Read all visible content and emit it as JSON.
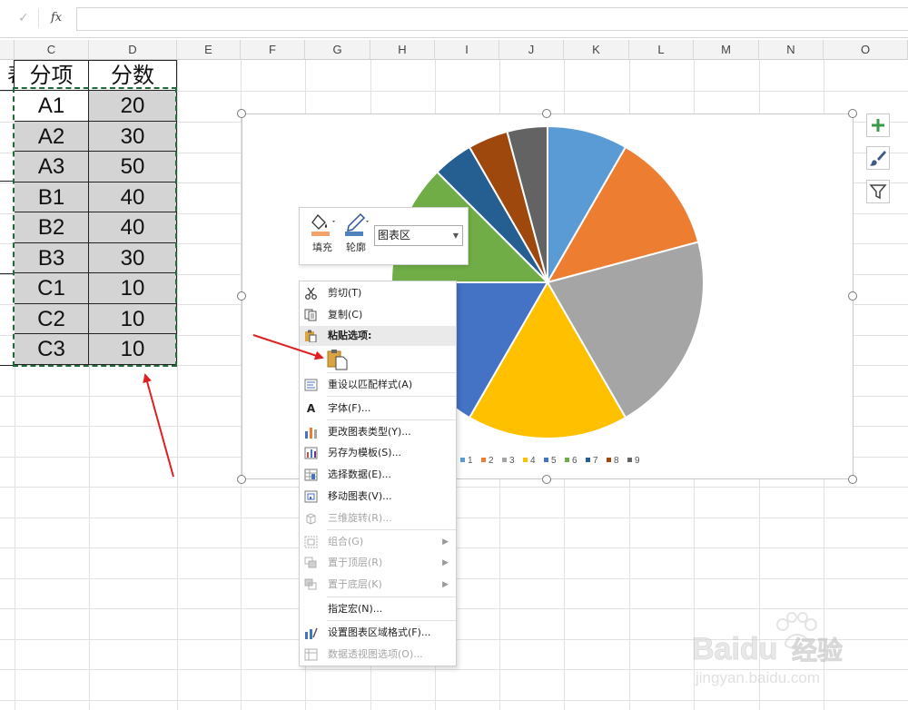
{
  "formula_bar": {
    "check_symbol": "✓",
    "fx_label": "fx",
    "value": ""
  },
  "columns": [
    "C",
    "D",
    "E",
    "F",
    "G",
    "H",
    "I",
    "J",
    "K",
    "L",
    "M",
    "N",
    "O"
  ],
  "partial_column_cell": "表",
  "table": {
    "headers": [
      "分项",
      "分数"
    ],
    "rows": [
      {
        "item": "A1",
        "score": "20"
      },
      {
        "item": "A2",
        "score": "30"
      },
      {
        "item": "A3",
        "score": "50"
      },
      {
        "item": "B1",
        "score": "40"
      },
      {
        "item": "B2",
        "score": "40"
      },
      {
        "item": "B3",
        "score": "30"
      },
      {
        "item": "C1",
        "score": "10"
      },
      {
        "item": "C2",
        "score": "10"
      },
      {
        "item": "C3",
        "score": "10"
      }
    ]
  },
  "chart_data": {
    "type": "pie",
    "slices": [
      {
        "name": "1",
        "value": 20,
        "color": "#5b9bd5"
      },
      {
        "name": "2",
        "value": 30,
        "color": "#ed7d31"
      },
      {
        "name": "3",
        "value": 50,
        "color": "#a5a5a5"
      },
      {
        "name": "4",
        "value": 40,
        "color": "#ffc000"
      },
      {
        "name": "5",
        "value": 40,
        "color": "#4472c4"
      },
      {
        "name": "6",
        "value": 30,
        "color": "#70ad47"
      },
      {
        "name": "7",
        "value": 10,
        "color": "#255e91"
      },
      {
        "name": "8",
        "value": 10,
        "color": "#9e480e"
      },
      {
        "name": "9",
        "value": 10,
        "color": "#636363"
      }
    ],
    "legend": [
      "1",
      "2",
      "3",
      "4",
      "5",
      "6",
      "7",
      "8",
      "9"
    ],
    "legend_position": "bottom"
  },
  "chart_side_buttons": [
    "plus-icon",
    "brush-icon",
    "filter-icon"
  ],
  "mini_toolbar": {
    "fill_label": "填充",
    "outline_label": "轮廓",
    "chart_element": "图表区"
  },
  "context_menu": {
    "cut": "剪切(T)",
    "copy": "复制(C)",
    "paste_options": "粘贴选项:",
    "reset_style": "重设以匹配样式(A)",
    "font": "字体(F)...",
    "change_chart_type": "更改图表类型(Y)...",
    "save_as_template": "另存为模板(S)...",
    "select_data": "选择数据(E)...",
    "move_chart": "移动图表(V)...",
    "rotation_3d": "三维旋转(R)...",
    "group": "组合(G)",
    "bring_to_front": "置于顶层(R)",
    "send_to_back": "置于底层(K)",
    "assign_macro": "指定宏(N)...",
    "format_chart_area": "设置图表区域格式(F)...",
    "pivot_chart_options": "数据透视图选项(O)..."
  },
  "watermark": {
    "brand": "Baidu",
    "product": "经验",
    "url": "jingyan.baidu.com"
  },
  "colors": {
    "selection_border": "#1f6a3a",
    "annotation_arrow": "#e02020"
  }
}
